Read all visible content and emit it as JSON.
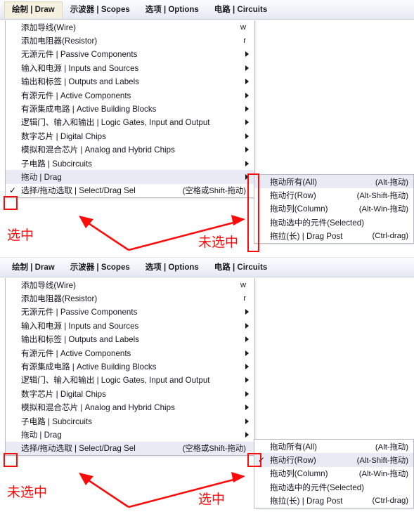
{
  "app": {
    "accent_red": "#fb0b09",
    "highlight_row": "#e8eaf4",
    "active_tab_bg": "#f6f1df"
  },
  "menubar": {
    "items": [
      {
        "label": "绘制 | Draw"
      },
      {
        "label": "示波器 | Scopes"
      },
      {
        "label": "选项 | Options"
      },
      {
        "label": "电路 | Circuits"
      }
    ]
  },
  "draw_menu": {
    "items": [
      {
        "label": "添加导线(Wire)",
        "accel": "w",
        "arrow": false,
        "check": false
      },
      {
        "label": "添加电阻器(Resistor)",
        "accel": "r",
        "arrow": false,
        "check": false
      },
      {
        "label": "无源元件 | Passive Components",
        "accel": "",
        "arrow": true,
        "check": false
      },
      {
        "label": "输入和电源 | Inputs and Sources",
        "accel": "",
        "arrow": true,
        "check": false
      },
      {
        "label": "输出和标签 | Outputs and Labels",
        "accel": "",
        "arrow": true,
        "check": false
      },
      {
        "label": "有源元件 | Active Components",
        "accel": "",
        "arrow": true,
        "check": false
      },
      {
        "label": "有源集成电路 | Active Building Blocks",
        "accel": "",
        "arrow": true,
        "check": false
      },
      {
        "label": "逻辑门、输入和输出 | Logic Gates, Input and Output",
        "accel": "",
        "arrow": true,
        "check": false
      },
      {
        "label": "数字芯片 | Digital Chips",
        "accel": "",
        "arrow": true,
        "check": false
      },
      {
        "label": "模拟和混合芯片 | Analog and Hybrid Chips",
        "accel": "",
        "arrow": true,
        "check": false
      },
      {
        "label": "子电路 | Subcircuits",
        "accel": "",
        "arrow": true,
        "check": false
      },
      {
        "label": "拖动 | Drag",
        "accel": "",
        "arrow": true,
        "check": false
      },
      {
        "label": "选择/拖动选取 | Select/Drag Sel",
        "accel": "(空格或Shift-拖动)",
        "arrow": false,
        "check": true
      }
    ]
  },
  "drag_submenu": {
    "items": [
      {
        "label": "拖动所有(All)",
        "accel": "(Alt-拖动)"
      },
      {
        "label": "拖动行(Row)",
        "accel": "(Alt-Shift-拖动)"
      },
      {
        "label": "拖动列(Column)",
        "accel": "(Alt-Win-拖动)"
      },
      {
        "label": "拖动选中的元件(Selected)",
        "accel": ""
      },
      {
        "label": "拖拉(长) | Drag Post",
        "accel": "(Ctrl-drag)"
      }
    ]
  },
  "panel1": {
    "check_mark": "✓",
    "select_drag_checked": true,
    "drag_row_highlighted": true,
    "submenu_checked_index": -1,
    "submenu_highlight_index": 0,
    "annotation_left": "选中",
    "annotation_right": "未选中"
  },
  "panel2": {
    "check_mark": "✓",
    "select_drag_checked": false,
    "select_drag_highlighted": true,
    "drag_row_highlighted": false,
    "submenu_checked_index": 1,
    "submenu_highlight_index": 1,
    "annotation_left": "未选中",
    "annotation_right": "选中"
  }
}
